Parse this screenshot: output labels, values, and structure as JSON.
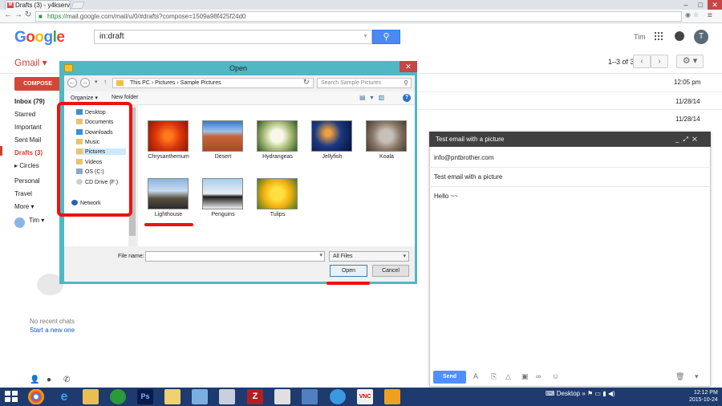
{
  "browser": {
    "tab_title": "Drafts (3) - y4kserve",
    "url_https": "https://",
    "url_rest": "mail.google.com/mail/u/0/#drafts?compose=1509a98f425f24d0"
  },
  "gmail": {
    "logo": "Google",
    "search_value": "in:draft",
    "user_name": "Tim",
    "avatar_letter": "T",
    "app_label": "Gmail",
    "page_info": "1–3 of 3",
    "compose_label": "COMPOSE",
    "sidebar": {
      "inbox": "Inbox (79)",
      "starred": "Starred",
      "important": "Important",
      "sent": "Sent Mail",
      "drafts": "Drafts (3)",
      "circles": "Circles",
      "personal": "Personal",
      "travel": "Travel",
      "more": "More"
    },
    "people_name": "Tim",
    "no_recent": "No recent chats",
    "start_new": "Start a new one",
    "mail_times": [
      "12:05 pm",
      "11/28/14",
      "11/28/14"
    ]
  },
  "compose_window": {
    "title": "Test email with a picture",
    "to": "info@pntbrother.com",
    "subject": "Test email with a picture",
    "body": "Hello ~~",
    "send_label": "Send"
  },
  "dialog": {
    "title": "Open",
    "breadcrumb": [
      "This PC",
      "Pictures",
      "Sample Pictures"
    ],
    "search_placeholder": "Search Sample Pictures",
    "organize": "Organize",
    "new_folder": "New folder",
    "nav_items": [
      "Desktop",
      "Documents",
      "Downloads",
      "Music",
      "Pictures",
      "Videos",
      "OS (C:)",
      "CD Drive (F:)",
      "Network"
    ],
    "files": [
      "Chrysanthemum",
      "Desert",
      "Hydrangeas",
      "Jellyfish",
      "Koala",
      "Lighthouse",
      "Penguins",
      "Tulips"
    ],
    "file_name_label": "File name:",
    "file_type": "All Files",
    "open_label": "Open",
    "cancel_label": "Cancel"
  },
  "taskbar": {
    "desktop_label": "Desktop",
    "time": "12:12 PM",
    "date": "2015-10-24"
  }
}
